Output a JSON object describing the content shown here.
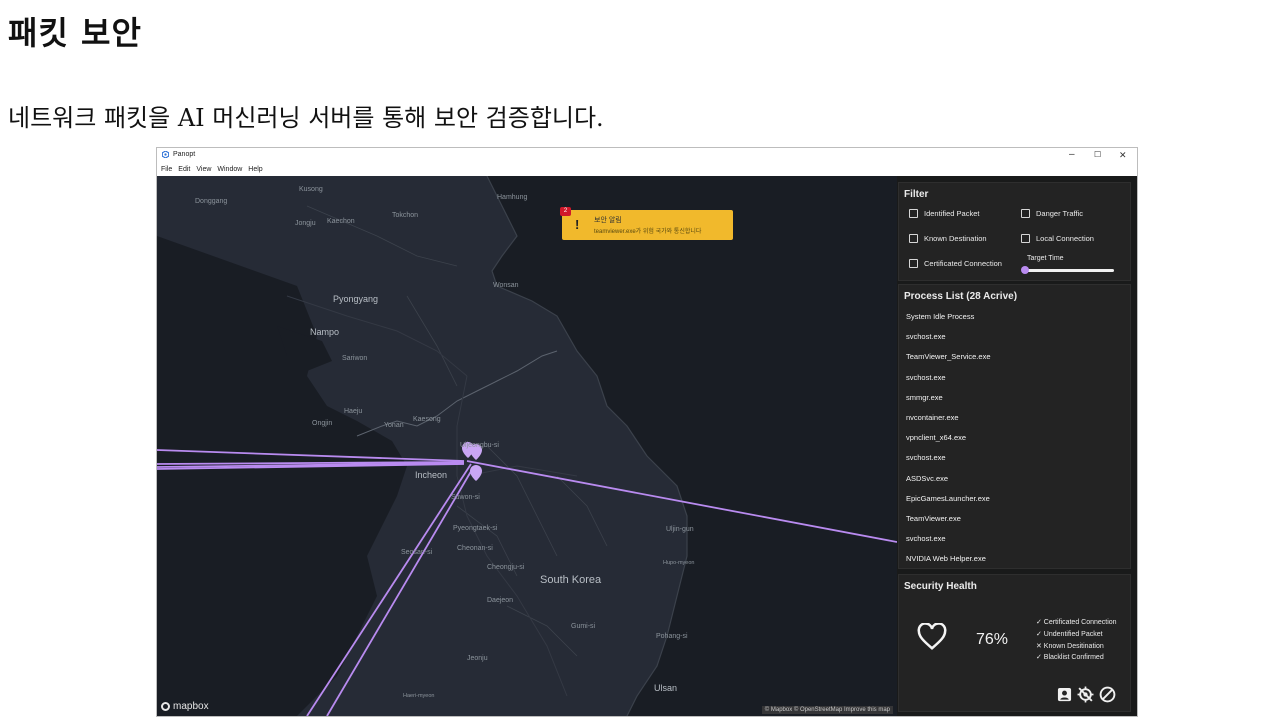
{
  "page": {
    "title": "패킷 보안",
    "subtitle": "네트워크 패킷을 AI 머신러닝 서버를 통해 보안 검증합니다."
  },
  "window": {
    "title": "Panopt",
    "controls": {
      "minimize": "–",
      "maximize": "☐",
      "close": "✕"
    },
    "menu": [
      "File",
      "Edit",
      "View",
      "Window",
      "Help"
    ]
  },
  "map": {
    "labels": {
      "kusong": "Kusong",
      "hamhung": "Hamhung",
      "donggang": "Donggang",
      "jongju": "Jongju",
      "kaechon": "Kaechon",
      "tokchon": "Tokchon",
      "pyongyang": "Pyongyang",
      "wonsan": "Wonsan",
      "nampo": "Nampo",
      "sariwon": "Sariwon",
      "haeju": "Haeju",
      "kaesong": "Kaesong",
      "ongjin": "Ongjin",
      "yonan": "Yonan",
      "uijeongbu": "Uijeongbu-si",
      "incheon": "Incheon",
      "suwon": "Suwon-si",
      "pyeongtaek": "Pyeongtaek-si",
      "seosan": "Seosan-si",
      "cheonan": "Cheonan-si",
      "cheongju": "Cheongju-si",
      "south_korea": "South Korea",
      "daejeon": "Daejeon",
      "uljin": "Uljin-gun",
      "hupo": "Hupo-myeon",
      "gumi": "Gumi-si",
      "pohang": "Pohang-si",
      "jeonju": "Jeonju",
      "ulsan": "Ulsan",
      "haeri": "Haeri-myeon"
    },
    "logo": "mapbox",
    "attribution": "© Mapbox © OpenStreetMap  Improve this map"
  },
  "alert": {
    "count": "2",
    "title": "보안 알림",
    "message": "teamviewer.exe가 위험 국가와 통신합니다"
  },
  "filter": {
    "title": "Filter",
    "options": {
      "identified_packet": "Identified Packet",
      "danger_traffic": "Danger Traffic",
      "known_destination": "Known Destination",
      "local_connection": "Local Connection",
      "certificated_connection": "Certificated Connection"
    },
    "target_time_label": "Target Time",
    "target_time_value": 0
  },
  "process_list": {
    "title": "Process List (28 Acrive)",
    "items": [
      "System Idle Process",
      "svchost.exe",
      "TeamViewer_Service.exe",
      "svchost.exe",
      "smmgr.exe",
      "nvcontainer.exe",
      "vpnclient_x64.exe",
      "svchost.exe",
      "ASDSvc.exe",
      "EpicGamesLauncher.exe",
      "TeamViewer.exe",
      "svchost.exe",
      "NVIDIA Web Helper.exe"
    ]
  },
  "security_health": {
    "title": "Security Health",
    "percent": "76%",
    "checks": [
      "✓ Certificated Connection",
      "✓ Undentified Packet",
      "✕ Known Desitination",
      "✓ Blacklist Confirmed"
    ]
  },
  "colors": {
    "map_bg": "#191d24",
    "land": "#262b36",
    "connection_line": "#b98bf0",
    "alert_bg": "#f1b92c",
    "panel_bg": "#232323"
  }
}
